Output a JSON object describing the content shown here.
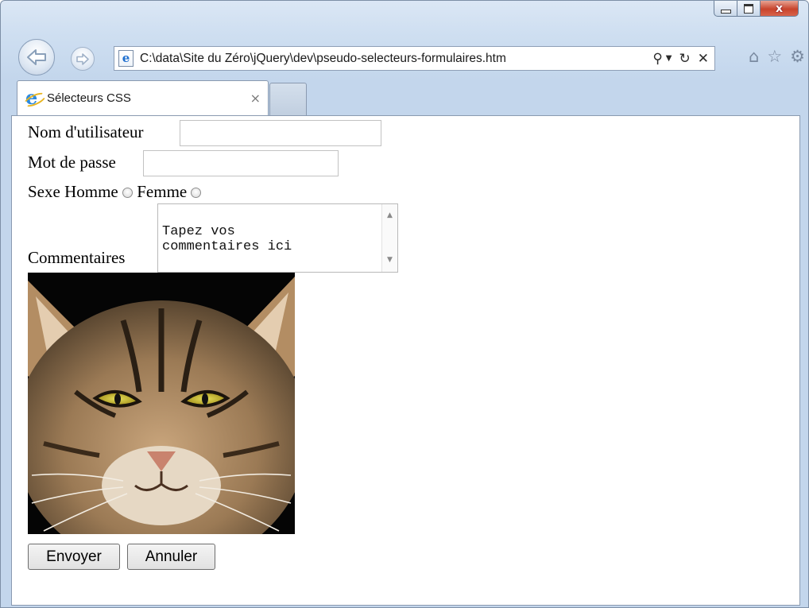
{
  "window": {
    "controls": {
      "minimize": "minimize",
      "maximize": "maximize",
      "close": "x"
    }
  },
  "browser": {
    "address": "C:\\data\\Site du Zéro\\jQuery\\dev\\pseudo-selecteurs-formulaires.htm",
    "tab_title": "Sélecteurs CSS",
    "tab_close": "×"
  },
  "icons": {
    "back": "arrow-left",
    "forward": "arrow-right",
    "search": "search",
    "dropdown": "chevron-down",
    "refresh": "refresh",
    "stop": "close",
    "home": "home",
    "favorites": "star",
    "tools": "gear"
  },
  "form": {
    "username_label": "Nom d'utilisateur",
    "username_value": "",
    "password_label": "Mot de passe",
    "password_value": "",
    "gender_label": "Sexe",
    "gender_male": "Homme",
    "gender_female": "Femme",
    "comments_label": "Commentaires",
    "comments_value": "Tapez vos\ncommentaires ici",
    "submit_label": "Envoyer",
    "cancel_label": "Annuler"
  },
  "colors": {
    "chrome_top": "#dbe7f5",
    "close_button": "#c8442c",
    "link_blue": "#2d8ae0"
  }
}
